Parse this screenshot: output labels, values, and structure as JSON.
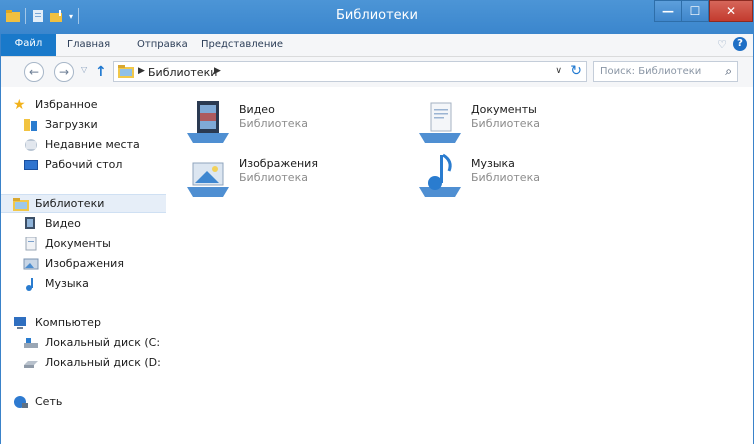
{
  "window": {
    "title": "Библиотеки",
    "accent": "#3b86cd",
    "close_color": "#c33b2e"
  },
  "ribbon": {
    "tab_file": "Файл",
    "tabs": [
      "Главная",
      "Отправка",
      "Представление"
    ]
  },
  "navigation": {
    "breadcrumb": "Библиотеки",
    "search_placeholder": "Поиск: Библиотеки"
  },
  "sidebar": {
    "favorites": {
      "label": "Избранное",
      "items": [
        "Загрузки",
        "Недавние места",
        "Рабочий стол"
      ]
    },
    "libraries": {
      "label": "Библиотеки",
      "items": [
        "Видео",
        "Документы",
        "Изображения",
        "Музыка"
      ]
    },
    "computer": {
      "label": "Компьютер",
      "items": [
        "Локальный диск (C:",
        "Локальный диск (D:"
      ]
    },
    "network": {
      "label": "Сеть"
    }
  },
  "libraries": [
    {
      "name": "Видео",
      "type": "Библиотека",
      "icon": "video-library-icon"
    },
    {
      "name": "Документы",
      "type": "Библиотека",
      "icon": "documents-library-icon"
    },
    {
      "name": "Изображения",
      "type": "Библиотека",
      "icon": "pictures-library-icon"
    },
    {
      "name": "Музыка",
      "type": "Библиотека",
      "icon": "music-library-icon"
    }
  ]
}
